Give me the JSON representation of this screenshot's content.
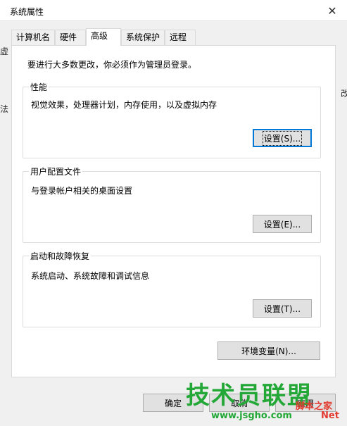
{
  "window": {
    "title": "系统属性",
    "close_icon": "✕"
  },
  "tabs": [
    {
      "label": "计算机名"
    },
    {
      "label": "硬件"
    },
    {
      "label": "高级"
    },
    {
      "label": "系统保护"
    },
    {
      "label": "远程"
    }
  ],
  "notice": "要进行大多数更改，你必须作为管理员登录。",
  "groups": [
    {
      "label": "性能",
      "desc": "视觉效果，处理器计划，内存使用，以及虚拟内存",
      "button": "设置(S)..."
    },
    {
      "label": "用户配置文件",
      "desc": "与登录帐户相关的桌面设置",
      "button": "设置(E)..."
    },
    {
      "label": "启动和故障恢复",
      "desc": "系统启动、系统故障和调试信息",
      "button": "设置(T)..."
    }
  ],
  "env_button": "环境变量(N)...",
  "footer": {
    "ok": "确定",
    "cancel": "取消",
    "apply": "应用"
  },
  "watermark": {
    "main": "技术员联盟",
    "sub": "脚本之家",
    "url": "www.jsgho.com",
    "net": "Net"
  }
}
